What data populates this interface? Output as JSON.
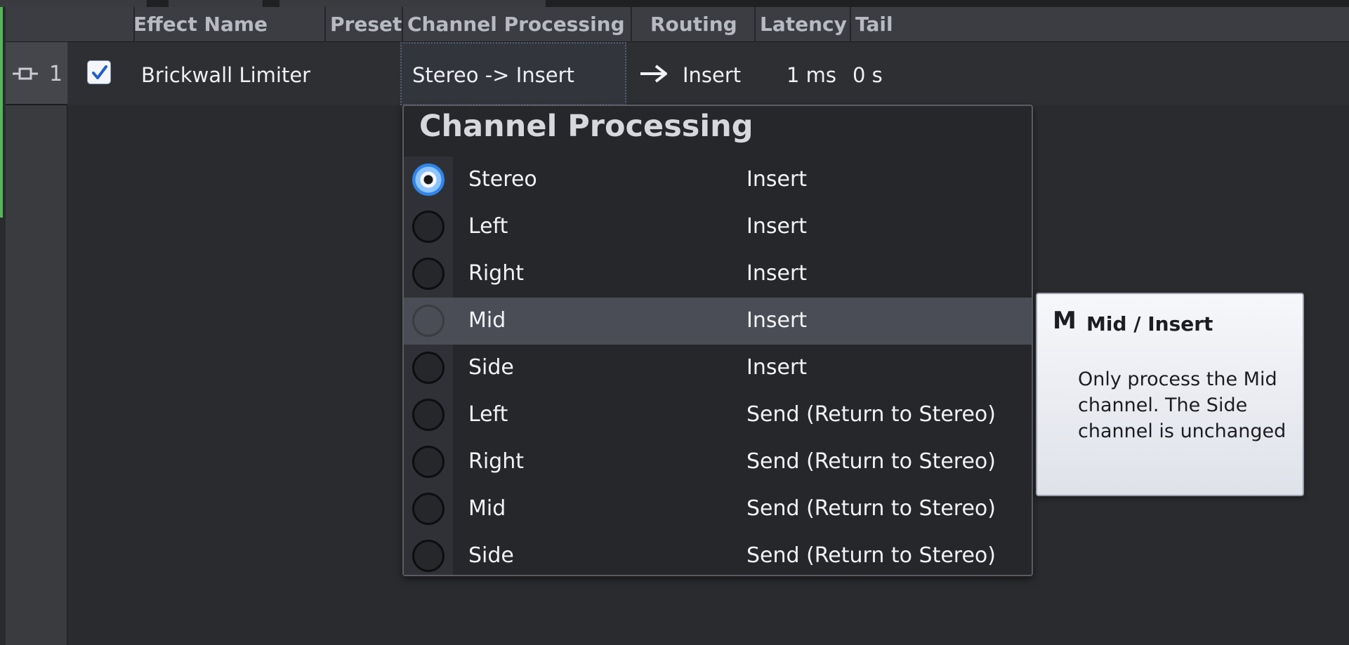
{
  "header": {
    "effect_name": "Effect Name",
    "preset": "Preset",
    "channel_processing": "Channel Processing",
    "routing": "Routing",
    "latency": "Latency",
    "tail": "Tail"
  },
  "row": {
    "slot_number": "1",
    "enabled": true,
    "effect_name": "Brickwall Limiter",
    "channel_processing": "Stereo -> Insert",
    "routing": "Insert",
    "latency": "1 ms",
    "tail": "0 s"
  },
  "popup": {
    "title": "Channel Processing",
    "items": [
      {
        "label": "Stereo",
        "route": "Insert",
        "selected": true,
        "highlighted": false
      },
      {
        "label": "Left",
        "route": "Insert",
        "selected": false,
        "highlighted": false
      },
      {
        "label": "Right",
        "route": "Insert",
        "selected": false,
        "highlighted": false
      },
      {
        "label": "Mid",
        "route": "Insert",
        "selected": false,
        "highlighted": true
      },
      {
        "label": "Side",
        "route": "Insert",
        "selected": false,
        "highlighted": false
      },
      {
        "label": "Left",
        "route": "Send (Return to Stereo)",
        "selected": false,
        "highlighted": false
      },
      {
        "label": "Right",
        "route": "Send (Return to Stereo)",
        "selected": false,
        "highlighted": false
      },
      {
        "label": "Mid",
        "route": "Send (Return to Stereo)",
        "selected": false,
        "highlighted": false
      },
      {
        "label": "Side",
        "route": "Send (Return to Stereo)",
        "selected": false,
        "highlighted": false
      }
    ]
  },
  "tooltip": {
    "hotkey": "M",
    "title": "Mid / Insert",
    "body": "Only process the Mid channel. The Side channel is unchanged"
  },
  "colors": {
    "background": "#2a2b2e",
    "header": "#3c3d42",
    "highlight": "#4b4d56",
    "radio_selected": "#2f86ea",
    "accent_edge": "#55b65a"
  }
}
